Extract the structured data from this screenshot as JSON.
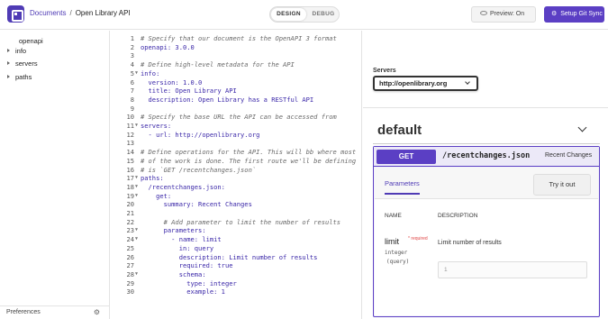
{
  "header": {
    "breadcrumb_root": "Documents",
    "breadcrumb_sep": "/",
    "breadcrumb_current": "Open Library API",
    "mode_design": "DESIGN",
    "mode_debug": "DEBUG",
    "preview_label": "Preview: On",
    "sync_label": "Setup Git Sync"
  },
  "sidebar": {
    "root": "openapi",
    "items": [
      {
        "label": "info"
      },
      {
        "label": "servers"
      },
      {
        "label": "paths"
      }
    ],
    "preferences": "Preferences"
  },
  "editor": {
    "lines": [
      {
        "n": "1",
        "t": "# Specify that our document is the OpenAPI 3 format",
        "c": "cm"
      },
      {
        "n": "2",
        "t": "openapi: 3.0.0",
        "c": "k"
      },
      {
        "n": "3",
        "t": "",
        "c": "v"
      },
      {
        "n": "4",
        "t": "# Define high-level metadata for the API",
        "c": "cm"
      },
      {
        "n": "5",
        "t": "info:",
        "c": "k",
        "f": true
      },
      {
        "n": "6",
        "t": "  version: 1.0.0",
        "c": "k"
      },
      {
        "n": "7",
        "t": "  title: Open Library API",
        "c": "k"
      },
      {
        "n": "8",
        "t": "  description: Open Library has a RESTful API",
        "c": "k"
      },
      {
        "n": "9",
        "t": "",
        "c": "v"
      },
      {
        "n": "10",
        "t": "# Specify the base URL the API can be accessed from",
        "c": "cm"
      },
      {
        "n": "11",
        "t": "servers:",
        "c": "k",
        "f": true
      },
      {
        "n": "12",
        "t": "  - url: http://openlibrary.org",
        "c": "k"
      },
      {
        "n": "13",
        "t": "",
        "c": "v"
      },
      {
        "n": "14",
        "t": "# Define operations for the API. This will bb where most",
        "c": "cm"
      },
      {
        "n": "15",
        "t": "# of the work is done. The first route we'll be defining",
        "c": "cm"
      },
      {
        "n": "16",
        "t": "# is `GET /recentchanges.json`",
        "c": "cm"
      },
      {
        "n": "17",
        "t": "paths:",
        "c": "k",
        "f": true
      },
      {
        "n": "18",
        "t": "  /recentchanges.json:",
        "c": "k",
        "f": true
      },
      {
        "n": "19",
        "t": "    get:",
        "c": "k",
        "f": true
      },
      {
        "n": "20",
        "t": "      summary: Recent Changes",
        "c": "k"
      },
      {
        "n": "21",
        "t": "",
        "c": "v"
      },
      {
        "n": "22",
        "t": "      # Add parameter to limit the number of results",
        "c": "cm"
      },
      {
        "n": "23",
        "t": "      parameters:",
        "c": "k",
        "f": true
      },
      {
        "n": "24",
        "t": "        - name: limit",
        "c": "k",
        "f": true
      },
      {
        "n": "25",
        "t": "          in: query",
        "c": "k"
      },
      {
        "n": "26",
        "t": "          description: Limit number of results",
        "c": "k"
      },
      {
        "n": "27",
        "t": "          required: true",
        "c": "k"
      },
      {
        "n": "28",
        "t": "          schema:",
        "c": "k",
        "f": true
      },
      {
        "n": "29",
        "t": "            type: integer",
        "c": "k"
      },
      {
        "n": "30",
        "t": "            example: 1",
        "c": "k"
      }
    ]
  },
  "preview": {
    "servers_label": "Servers",
    "server_value": "http://openlibrary.org",
    "tag_name": "default",
    "operation": {
      "method": "GET",
      "path": "/recentchanges.json",
      "summary": "Recent Changes",
      "tab_parameters": "Parameters",
      "try_label": "Try it out",
      "col_name": "NAME",
      "col_description": "DESCRIPTION",
      "param_name": "limit",
      "param_required_mark": "* required",
      "param_type": "integer",
      "param_in": "(query)",
      "param_description": "Limit number of results",
      "param_placeholder": "1"
    }
  },
  "colors": {
    "accent": "#5b3fc4",
    "comment": "#6a6a6a",
    "key": "#3a27a8"
  }
}
